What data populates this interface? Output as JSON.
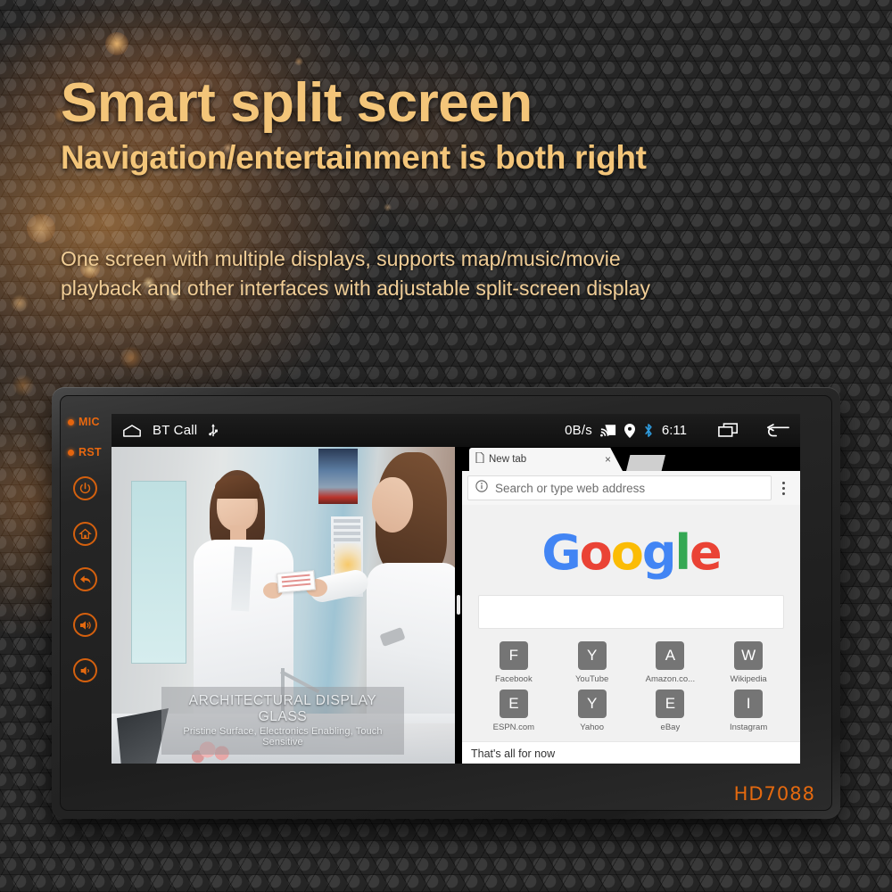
{
  "hero": {
    "headline": "Smart split screen",
    "subheadline": "Navigation/entertainment is both right",
    "description_line1": "One screen with multiple displays, supports map/music/movie",
    "description_line2": "playback and other interfaces with adjustable split-screen display",
    "accent_color": "#f3c579",
    "body_color": "#f0cd96"
  },
  "device": {
    "model": "HD7088",
    "model_color": "#e4690f",
    "side_buttons": [
      {
        "name": "mic",
        "label": "MIC",
        "type": "led"
      },
      {
        "name": "reset",
        "label": "RST",
        "type": "led"
      },
      {
        "name": "power",
        "label": "Power",
        "type": "icon"
      },
      {
        "name": "home",
        "label": "Home",
        "type": "icon"
      },
      {
        "name": "back",
        "label": "Back",
        "type": "icon"
      },
      {
        "name": "volume-up",
        "label": "Volume Up",
        "type": "icon"
      },
      {
        "name": "volume-down",
        "label": "Volume Down",
        "type": "icon"
      }
    ]
  },
  "statusbar": {
    "home_icon": "home-icon",
    "bt_call_label": "BT Call",
    "usb_icon": "usb-icon",
    "network_speed": "0B/s",
    "cast_icon": "cast-icon",
    "location_icon": "location-pin-icon",
    "bluetooth_icon": "bluetooth-icon",
    "bluetooth_color": "#2f9bdd",
    "time": "6:11",
    "recents_icon": "recent-apps-icon",
    "back_icon": "back-arrow-icon"
  },
  "video": {
    "caption_title": "ARCHITECTURAL DISPLAY GLASS",
    "caption_subtitle": "Pristine Surface, Electronics Enabling, Touch Sensitive"
  },
  "browser": {
    "tab": {
      "title": "New tab",
      "close_label": "×"
    },
    "omnibox": {
      "placeholder": "Search or type web address",
      "info_icon": "info-circle-icon"
    },
    "menu_icon": "overflow-menu-icon",
    "logo": {
      "letters": [
        "G",
        "o",
        "o",
        "g",
        "l",
        "e"
      ],
      "colors": [
        "#4285f4",
        "#ea4335",
        "#fbbc05",
        "#4285f4",
        "#34a853",
        "#ea4335"
      ]
    },
    "tiles": [
      {
        "initial": "F",
        "label": "Facebook"
      },
      {
        "initial": "Y",
        "label": "YouTube"
      },
      {
        "initial": "A",
        "label": "Amazon.co..."
      },
      {
        "initial": "W",
        "label": "Wikipedia"
      },
      {
        "initial": "E",
        "label": "ESPN.com"
      },
      {
        "initial": "Y",
        "label": "Yahoo"
      },
      {
        "initial": "E",
        "label": "eBay"
      },
      {
        "initial": "I",
        "label": "Instagram"
      }
    ],
    "footer_text": "That's all for now"
  }
}
